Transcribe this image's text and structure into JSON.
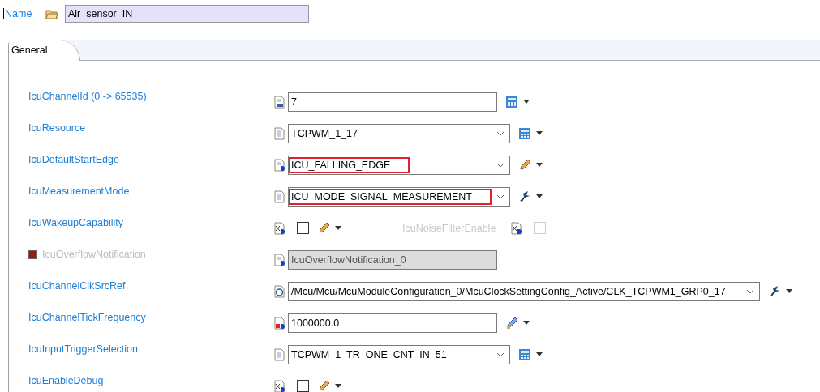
{
  "name_field": {
    "label": "Name",
    "value": "Air_sensor_IN"
  },
  "tabs": [
    {
      "label": "General",
      "selected": true
    }
  ],
  "rows": [
    {
      "label": "IcuChannelId (0 -> 65535)",
      "kind": "text",
      "type_icon": {
        "kind": "integer"
      },
      "value": "7",
      "action": {
        "kind": "calculator"
      },
      "highlighted": false,
      "disabled": false
    },
    {
      "label": "IcuResource",
      "kind": "combo",
      "type_icon": {
        "kind": "enum"
      },
      "value": "TCPWM_1_17",
      "action": {
        "kind": "calculator"
      },
      "highlighted": false,
      "disabled": false
    },
    {
      "label": "IcuDefaultStartEdge",
      "kind": "combo",
      "type_icon": {
        "kind": "derived"
      },
      "value": "ICU_FALLING_EDGE",
      "action": {
        "kind": "pencil"
      },
      "highlighted": true,
      "disabled": false
    },
    {
      "label": "IcuMeasurementMode",
      "kind": "combo",
      "type_icon": {
        "kind": "enum"
      },
      "value": "ICU_MODE_SIGNAL_MEASUREMENT",
      "action": {
        "kind": "wizard"
      },
      "highlighted": true,
      "disabled": false
    },
    {
      "label": "IcuWakeupCapability",
      "kind": "checkbox",
      "type_icon": {
        "kind": "boolean"
      },
      "checked": false,
      "action": {
        "kind": "pencil"
      },
      "disabled": false,
      "extra": {
        "label": "IcuNoiseFilterEnable",
        "type_icon": {
          "kind": "boolean"
        },
        "checked": false,
        "disabled": true
      }
    },
    {
      "label": "IcuOverflowNotification",
      "kind": "text",
      "type_icon": {
        "kind": "derived"
      },
      "value": "IcuOverflowNotification_0",
      "marker": true,
      "highlighted": false,
      "disabled": true
    },
    {
      "label": "IcuChannelClkSrcRef",
      "kind": "reference",
      "type_icon": {
        "kind": "reference"
      },
      "value": "/Mcu/Mcu/McuModuleConfiguration_0/McuClockSettingConfig_Active/CLK_TCPWM1_GRP0_17",
      "action": {
        "kind": "wizard"
      },
      "highlighted": false,
      "disabled": false
    },
    {
      "label": "IcuChannelTickFrequency",
      "kind": "text",
      "type_icon": {
        "kind": "float"
      },
      "value": "1000000.0",
      "action": {
        "kind": "ruler-pencil"
      },
      "highlighted": false,
      "disabled": false
    },
    {
      "label": "IcuInputTriggerSelection",
      "kind": "combo",
      "type_icon": {
        "kind": "enum"
      },
      "value": "TCPWM_1_TR_ONE_CNT_IN_51",
      "action": {
        "kind": "calculator"
      },
      "highlighted": false,
      "disabled": false
    },
    {
      "label": "IcuEnableDebug",
      "kind": "checkbox",
      "type_icon": {
        "kind": "boolean"
      },
      "checked": false,
      "action": {
        "kind": "pencil"
      },
      "disabled": false
    }
  ]
}
